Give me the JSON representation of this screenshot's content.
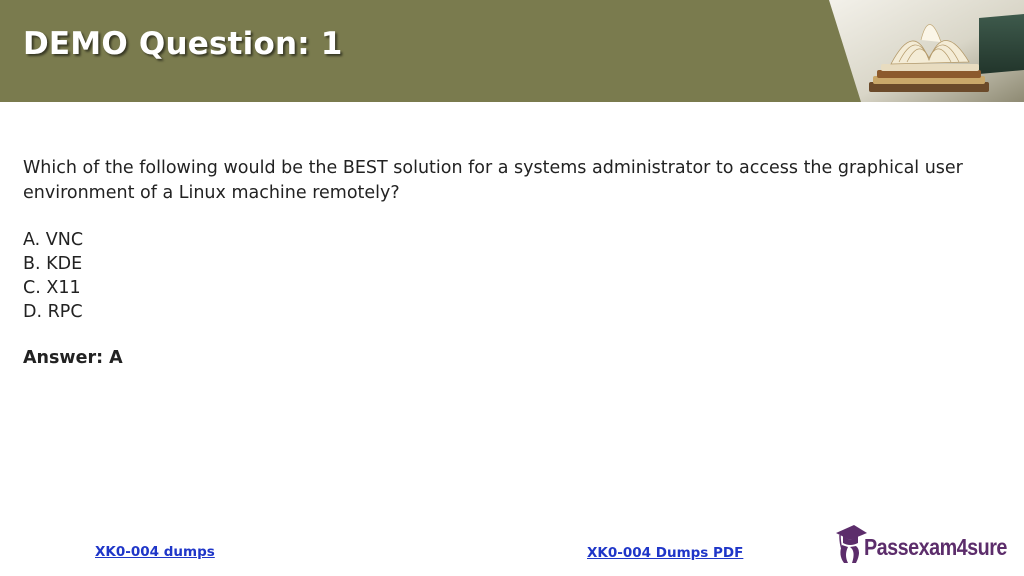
{
  "slide": {
    "title": "DEMO Question: 1",
    "question": "Which of the following would be the BEST solution for a systems administrator to access the graphical user environment of a Linux machine remotely?",
    "options": [
      "A. VNC",
      "B. KDE",
      "C. X11",
      "D. RPC"
    ],
    "answer": "Answer: A"
  },
  "footer": {
    "left_link": "XK0-004 dumps",
    "right_link": "XK0-004 Dumps PDF",
    "logo_text": "Passexam4sure"
  },
  "colors": {
    "header_bg": "#7a7b4e",
    "link": "#1f36c8",
    "logo": "#5c2d6b"
  },
  "icons": {
    "header_image": "books-image",
    "logo_icon": "graduation-cap-icon"
  }
}
